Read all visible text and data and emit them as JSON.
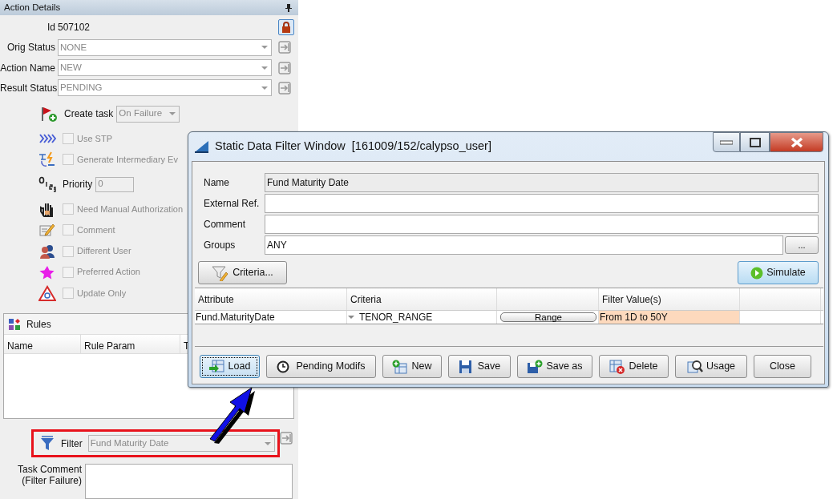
{
  "panel": {
    "title": "Action Details",
    "id": {
      "label": "Id",
      "value": "507102"
    },
    "selects": [
      {
        "label": "Orig Status",
        "value": "NONE"
      },
      {
        "label": "Action Name",
        "value": "NEW"
      },
      {
        "label": "Result Status",
        "value": "PENDING"
      }
    ],
    "create_task": {
      "label": "Create task",
      "value": "On Failure"
    },
    "options": [
      {
        "kind": "checkbox",
        "label": "Use STP",
        "checked": false,
        "disabled": true
      },
      {
        "kind": "checkbox",
        "label": "Generate Intermediary Ev",
        "checked": false,
        "disabled": true
      },
      {
        "kind": "field",
        "label": "Priority",
        "value": "0",
        "disabled": true
      },
      {
        "kind": "checkbox",
        "label": "Need Manual Authorization",
        "checked": false,
        "disabled": true
      },
      {
        "kind": "checkbox",
        "label": "Comment",
        "checked": false,
        "disabled": true
      },
      {
        "kind": "checkbox",
        "label": "Different User",
        "checked": false,
        "disabled": true
      },
      {
        "kind": "checkbox",
        "label": "Preferred Action",
        "checked": false,
        "disabled": true
      },
      {
        "kind": "checkbox",
        "label": "Update Only",
        "checked": false,
        "disabled": true
      }
    ],
    "rules": {
      "title": "Rules",
      "columns": [
        "Name",
        "Rule Param",
        "T"
      ]
    },
    "filter": {
      "label": "Filter",
      "value": "Fund Maturity Date"
    },
    "task_comment": {
      "label": "Task Comment (Filter Failure)"
    }
  },
  "dialog": {
    "title": "Static Data Filter Window  [161009/152/calypso_user]",
    "fields": [
      {
        "label": "Name",
        "value": "Fund Maturity Date",
        "readonly": true
      },
      {
        "label": "External Ref.",
        "readonly": false
      },
      {
        "label": "Comment",
        "readonly": false
      },
      {
        "label": "Groups",
        "value": "ANY",
        "readonly": false,
        "button": "..."
      }
    ],
    "criteria_button": "Criteria...",
    "simulate_button": "Simulate",
    "table": {
      "columns": [
        "Attribute",
        "Criteria",
        null,
        "Filter Value(s)",
        null
      ],
      "rows": [
        {
          "attribute": "Fund.MaturityDate",
          "criteria": "TENOR_RANGE",
          "range_button": "Range",
          "filter_value": "From 1D to 50Y"
        }
      ]
    },
    "buttons": [
      {
        "label": "Load",
        "focused": true
      },
      {
        "label": "Pending Modifs",
        "focused": false
      },
      {
        "label": "New",
        "focused": false
      },
      {
        "label": "Save",
        "focused": false
      },
      {
        "label": "Save as",
        "focused": false
      },
      {
        "label": "Delete",
        "focused": false
      },
      {
        "label": "Usage",
        "focused": false
      },
      {
        "label": "Close",
        "focused": false
      }
    ]
  }
}
